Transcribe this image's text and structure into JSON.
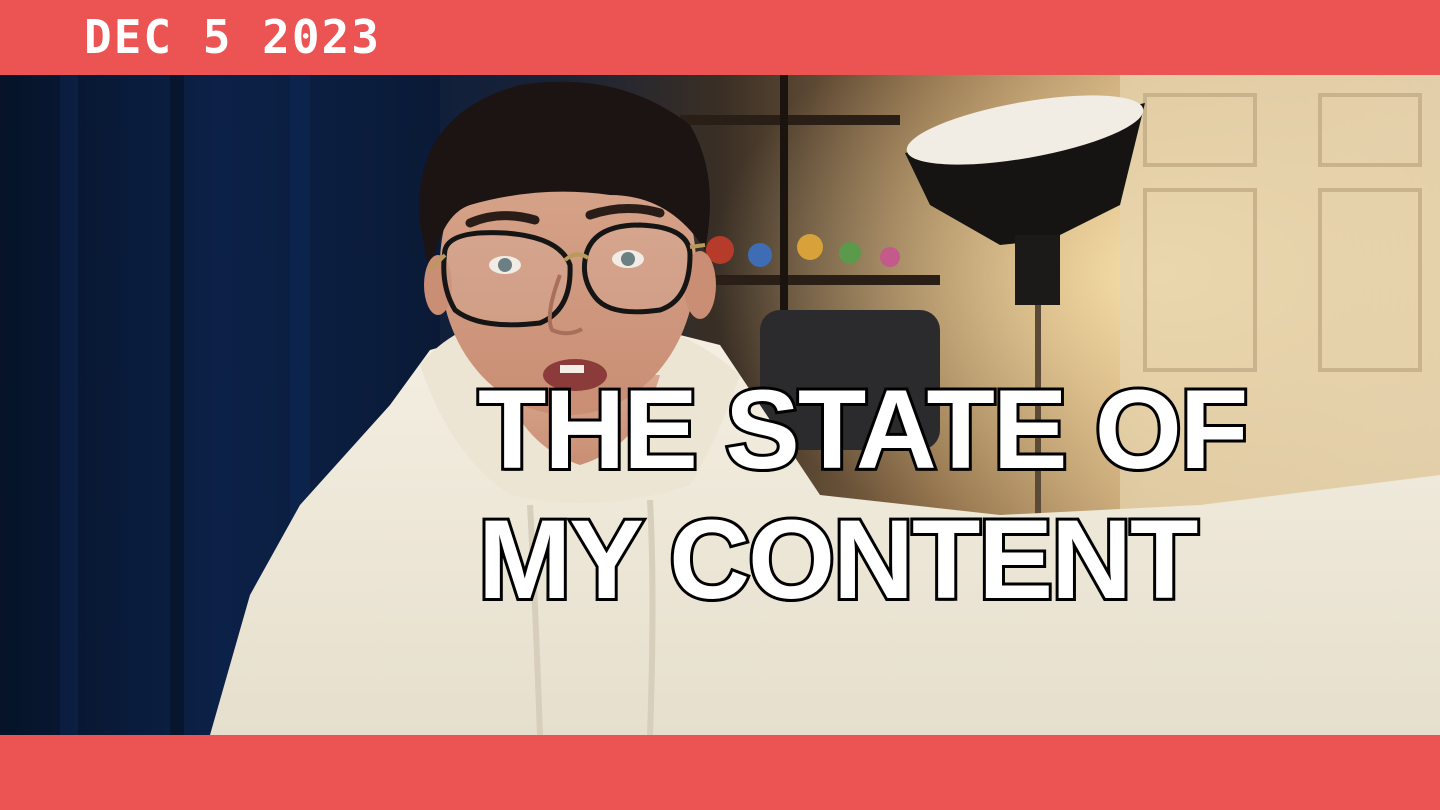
{
  "date": "DEC 5 2023",
  "headline": {
    "line1": "THE STATE OF",
    "line2": "MY CONTENT"
  },
  "colors": {
    "banner": "#ec5353",
    "text": "#ffffff",
    "outline": "#000000"
  }
}
